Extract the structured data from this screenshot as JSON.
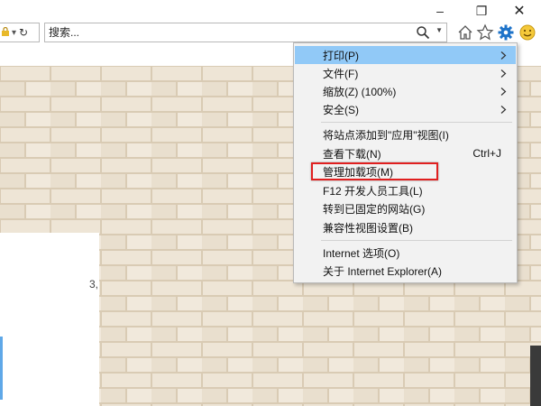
{
  "window": {
    "minimize_symbol": "–",
    "restore_symbol": "❐",
    "close_symbol": "✕"
  },
  "address": {
    "partial_dropdown": "▾",
    "refresh_symbol": "↻"
  },
  "search": {
    "placeholder": "搜索..."
  },
  "toolbar": {
    "icons": [
      "home-icon",
      "favorites-star-icon",
      "gear-icon",
      "smiley-feedback-icon"
    ],
    "accent": "#1e73c9"
  },
  "content": {
    "panel_fragment": "3,"
  },
  "menu": {
    "items": [
      {
        "label": "打印(P)",
        "submenu": true,
        "highlight": true
      },
      {
        "label": "文件(F)",
        "submenu": true
      },
      {
        "label": "缩放(Z) (100%)",
        "submenu": true
      },
      {
        "label": "安全(S)",
        "submenu": true
      },
      {
        "label": "将站点添加到\"应用\"视图(I)"
      },
      {
        "label": "查看下载(N)",
        "shortcut": "Ctrl+J"
      },
      {
        "label": "管理加载项(M)",
        "boxed": true
      },
      {
        "label": "F12 开发人员工具(L)"
      },
      {
        "label": "转到已固定的网站(G)"
      },
      {
        "label": "兼容性视图设置(B)"
      },
      {
        "label": "Internet 选项(O)"
      },
      {
        "label": "关于 Internet Explorer(A)"
      }
    ],
    "highlight_color": "#91c9f7",
    "annotation_color": "#e01f1f"
  }
}
